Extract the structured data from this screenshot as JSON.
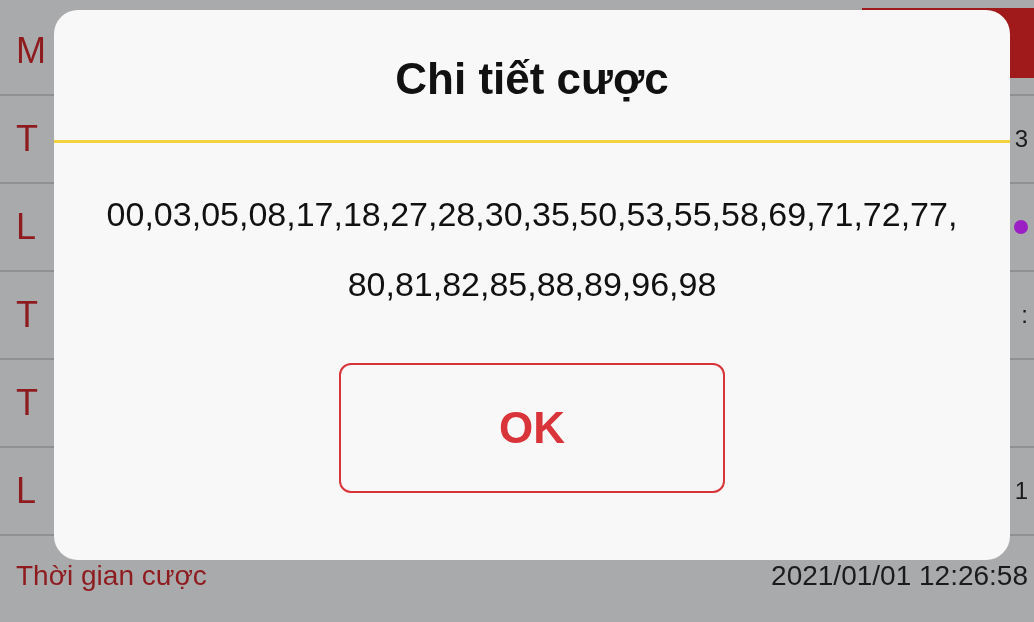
{
  "background_list": {
    "rows": [
      {
        "label": "M",
        "value": "",
        "kind": "text"
      },
      {
        "label": "T",
        "value": "3",
        "kind": "text"
      },
      {
        "label": "L",
        "value": "",
        "kind": "dot",
        "color": "#9b1fc4"
      },
      {
        "label": "T",
        "value": ":",
        "kind": "text"
      },
      {
        "label": "T",
        "value": "",
        "kind": "text"
      },
      {
        "label": "L",
        "value": "1",
        "kind": "text"
      },
      {
        "label": "Thời gian cược",
        "value": "2021/01/01 12:26:58",
        "kind": "text"
      }
    ]
  },
  "dialog": {
    "title": "Chi tiết cược",
    "body": "00,03,05,08,17,18,27,28,30,35,50,53,55,58,69,71,72,77,80,81,82,85,88,89,96,98",
    "button": "OK"
  }
}
